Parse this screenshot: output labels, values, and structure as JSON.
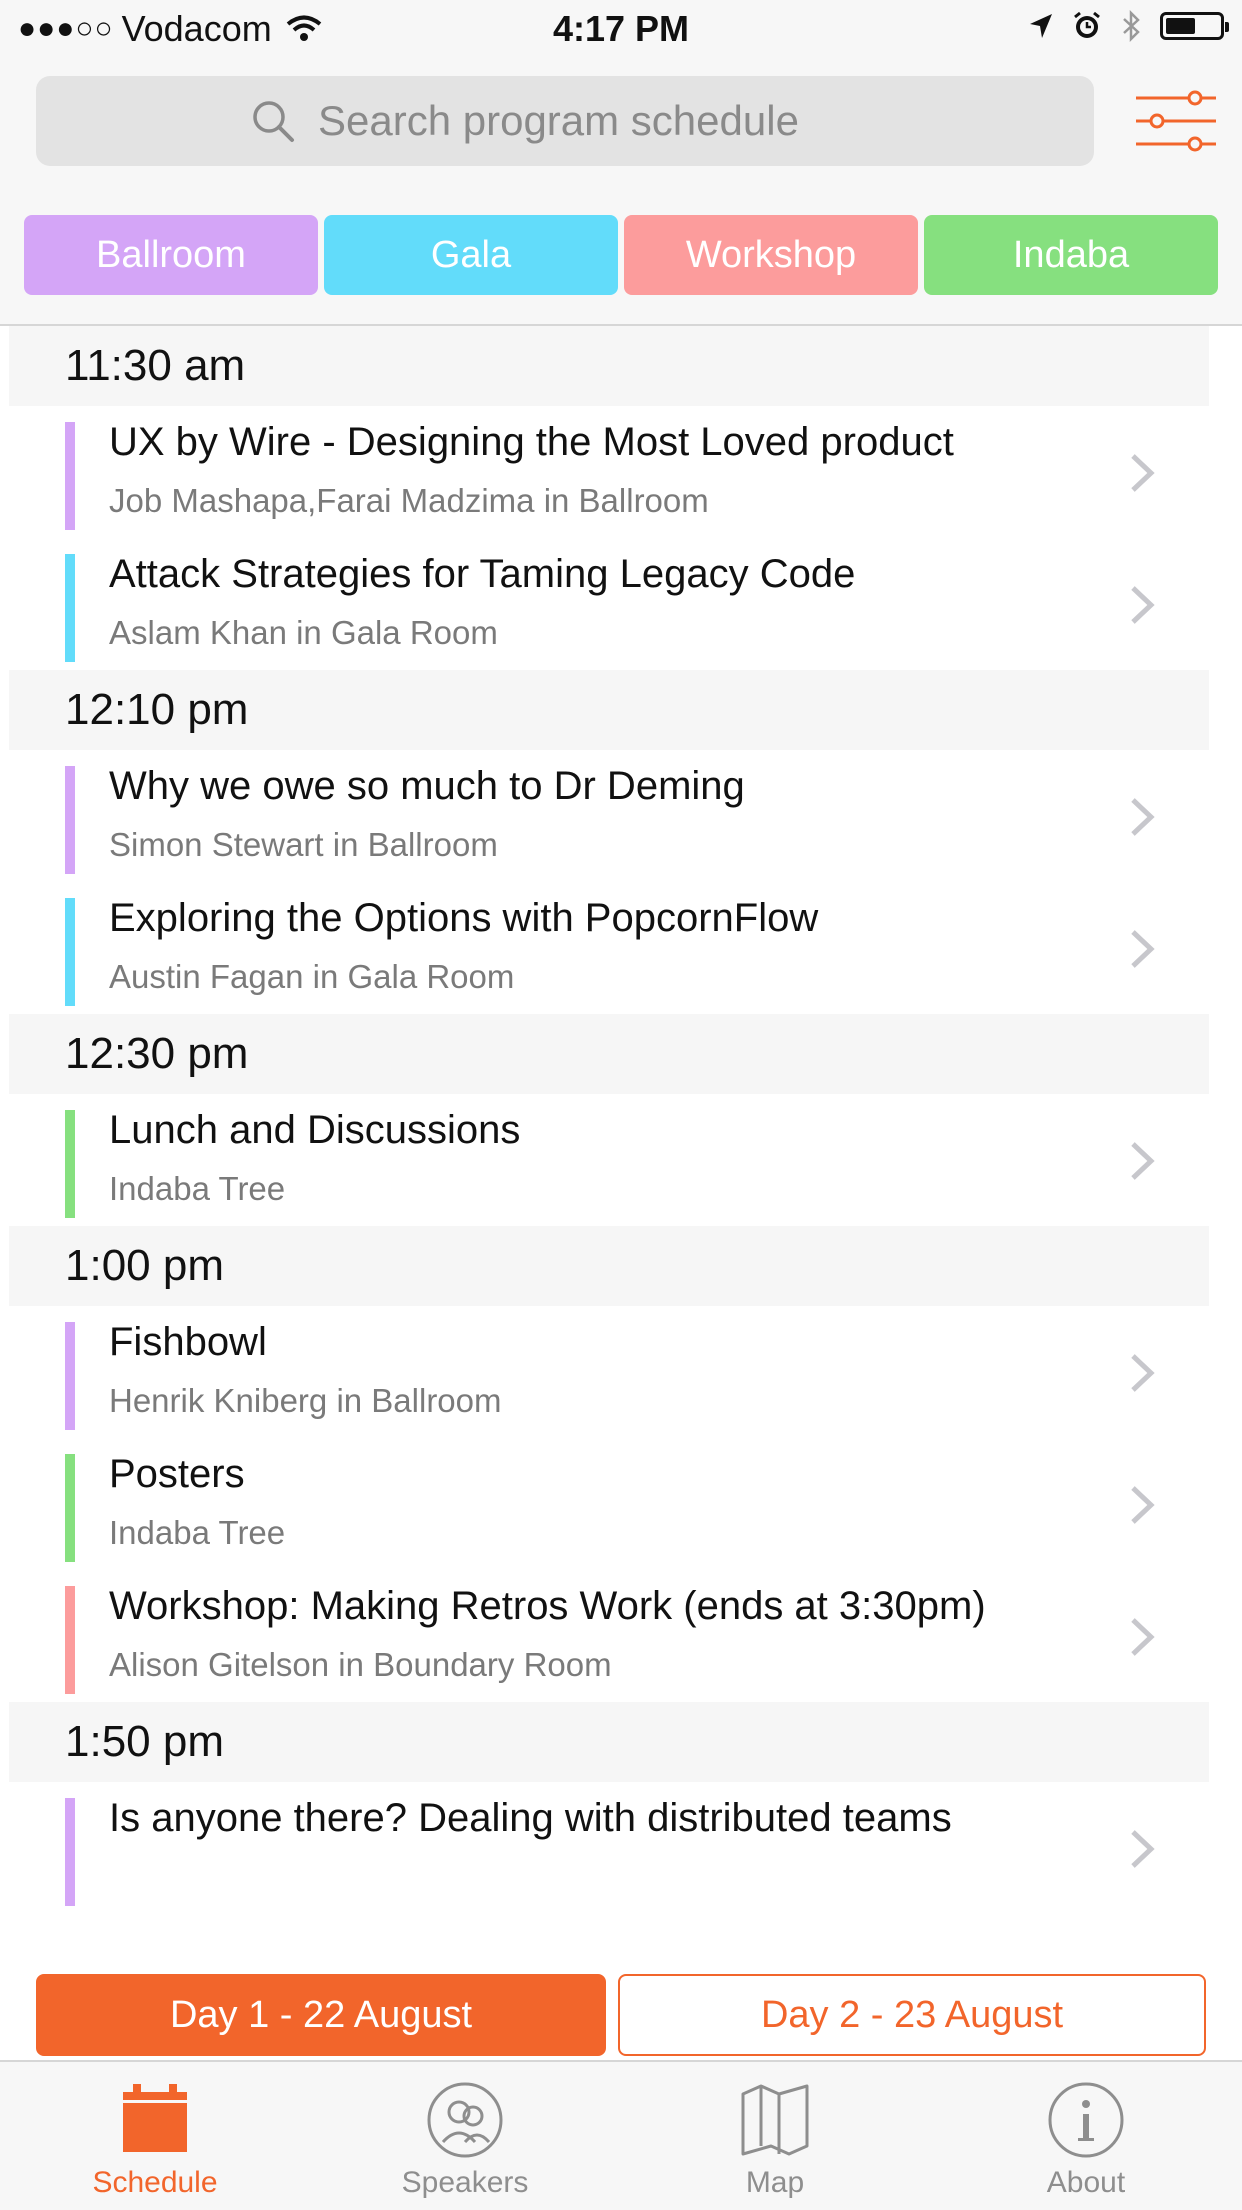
{
  "status_bar": {
    "signal": "●●●○○",
    "carrier": "Vodacom",
    "time": "4:17 PM"
  },
  "search": {
    "placeholder": "Search program schedule"
  },
  "rooms": [
    {
      "label": "Ballroom",
      "color": "#d4a5f7"
    },
    {
      "label": "Gala",
      "color": "#62dcfa"
    },
    {
      "label": "Workshop",
      "color": "#fc9c9c"
    },
    {
      "label": "Indaba",
      "color": "#86e07f"
    }
  ],
  "schedule": [
    {
      "time": "11:30 am",
      "sessions": [
        {
          "title": "UX by Wire - Designing the Most Loved product",
          "subtitle": "Job Mashapa,Farai Madzima in Ballroom",
          "color": "#d4a5f7"
        },
        {
          "title": "Attack Strategies for Taming Legacy Code",
          "subtitle": "Aslam Khan in Gala Room",
          "color": "#62dcfa"
        }
      ]
    },
    {
      "time": "12:10 pm",
      "sessions": [
        {
          "title": "Why we owe so much to Dr Deming",
          "subtitle": "Simon Stewart in Ballroom",
          "color": "#d4a5f7"
        },
        {
          "title": "Exploring the Options with PopcornFlow",
          "subtitle": "Austin Fagan in Gala Room",
          "color": "#62dcfa"
        }
      ]
    },
    {
      "time": "12:30 pm",
      "sessions": [
        {
          "title": "Lunch and Discussions",
          "subtitle": "Indaba Tree",
          "color": "#86e07f"
        }
      ]
    },
    {
      "time": "1:00 pm",
      "sessions": [
        {
          "title": "Fishbowl",
          "subtitle": "Henrik Kniberg in Ballroom",
          "color": "#d4a5f7"
        },
        {
          "title": "Posters",
          "subtitle": "Indaba Tree",
          "color": "#86e07f"
        },
        {
          "title": "Workshop: Making Retros Work (ends at 3:30pm)",
          "subtitle": "Alison Gitelson in Boundary Room",
          "color": "#fc9c9c"
        }
      ]
    },
    {
      "time": "1:50 pm",
      "sessions": [
        {
          "title": "Is anyone there? Dealing with distributed teams",
          "subtitle": "",
          "color": "#d4a5f7"
        }
      ]
    }
  ],
  "days": {
    "day1": "Day 1 - 22 August",
    "day2": "Day 2 - 23 August"
  },
  "tabs": [
    {
      "label": "Schedule",
      "icon": "calendar-icon"
    },
    {
      "label": "Speakers",
      "icon": "speakers-icon"
    },
    {
      "label": "Map",
      "icon": "map-icon"
    },
    {
      "label": "About",
      "icon": "info-icon"
    }
  ],
  "accent_color": "#f2652b"
}
